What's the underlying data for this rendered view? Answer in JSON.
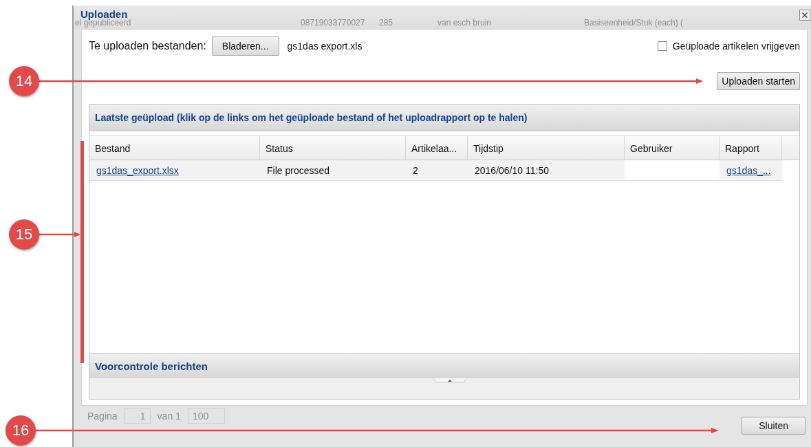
{
  "dialog": {
    "title": "Uploaden"
  },
  "background_row": [
    "el gepubliceerd",
    "08719033770027",
    "285",
    "van esch bruin",
    "Basiseenheid/Stuk (each) ("
  ],
  "upload": {
    "label": "Te uploaden bestanden:",
    "browse_button": "Bladeren...",
    "file_name": "gs1das export.xls",
    "release_checkbox": {
      "label": "Geüploade artikelen vrijgeven",
      "checked": false
    },
    "start_button": "Uploaden starten"
  },
  "recent_panel": {
    "title": "Laatste geüpload (klik op de links om het geüploade bestand of het uploadrapport op te halen)",
    "columns": [
      "Bestand",
      "Status",
      "Artikelaa...",
      "Tijdstip",
      "Gebruiker",
      "Rapport"
    ],
    "rows": [
      {
        "file": "gs1das_export.xlsx",
        "status": "File processed",
        "articles": "2",
        "time": "2016/06/10 11:50",
        "report": "gs1das_..."
      }
    ]
  },
  "precheck_panel": {
    "title": "Voorcontrole berichten"
  },
  "pager": {
    "label": "Pagina",
    "page": "1",
    "of": "van 1",
    "page_size": "100"
  },
  "close_button": "Sluiten",
  "callouts": [
    "14",
    "15",
    "16"
  ]
}
